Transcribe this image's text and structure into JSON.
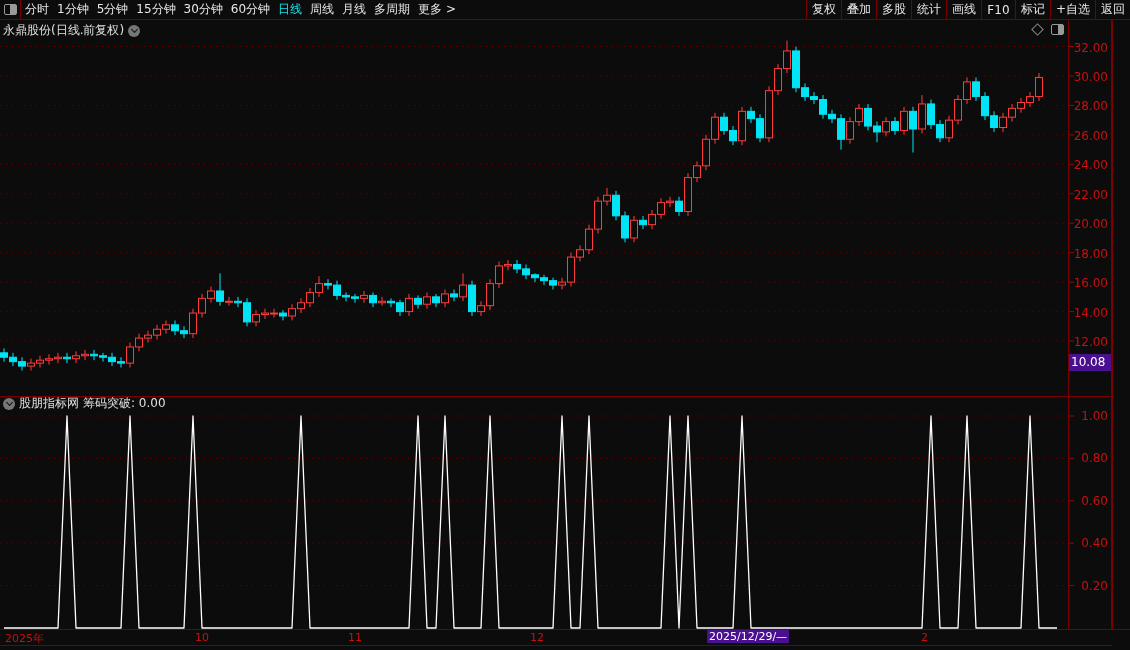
{
  "toolbar": {
    "periods": [
      {
        "label": "分时",
        "selected": false
      },
      {
        "label": "1分钟",
        "selected": false
      },
      {
        "label": "5分钟",
        "selected": false
      },
      {
        "label": "15分钟",
        "selected": false
      },
      {
        "label": "30分钟",
        "selected": false
      },
      {
        "label": "60分钟",
        "selected": false
      },
      {
        "label": "日线",
        "selected": true
      },
      {
        "label": "周线",
        "selected": false
      },
      {
        "label": "月线",
        "selected": false
      },
      {
        "label": "多周期",
        "selected": false
      },
      {
        "label": "更多 >",
        "selected": false
      }
    ],
    "actions": [
      "复权",
      "叠加",
      "多股",
      "统计",
      "画线",
      "F10",
      "标记",
      "+自选",
      "返回"
    ]
  },
  "main_chart": {
    "title": "永鼎股份(日线.前复权)",
    "cursor_price": "10.08",
    "chart_data": {
      "type": "candlestick",
      "grid": true,
      "ylim": [
        8.2,
        33.8
      ],
      "yticks": [
        {
          "value": 32,
          "label": "32.00"
        },
        {
          "value": 30,
          "label": "30.00"
        },
        {
          "value": 28,
          "label": "28.00"
        },
        {
          "value": 26,
          "label": "26.00"
        },
        {
          "value": 24,
          "label": "24.00"
        },
        {
          "value": 22,
          "label": "22.00"
        },
        {
          "value": 20,
          "label": "20.00"
        },
        {
          "value": 18,
          "label": "18.00"
        },
        {
          "value": 16,
          "label": "16.00"
        },
        {
          "value": 14,
          "label": "14.00"
        },
        {
          "value": 12,
          "label": "12.00"
        }
      ],
      "ohlc": [
        [
          11.2,
          11.5,
          10.6,
          10.9
        ],
        [
          10.9,
          11.2,
          10.3,
          10.6
        ],
        [
          10.6,
          10.9,
          10.0,
          10.3
        ],
        [
          10.3,
          10.8,
          10.0,
          10.5
        ],
        [
          10.5,
          11.0,
          10.2,
          10.7
        ],
        [
          10.7,
          11.1,
          10.4,
          10.8
        ],
        [
          10.8,
          11.2,
          10.5,
          10.9
        ],
        [
          10.9,
          11.2,
          10.5,
          10.8
        ],
        [
          10.8,
          11.3,
          10.5,
          11.0
        ],
        [
          11.0,
          11.4,
          10.7,
          11.1
        ],
        [
          11.1,
          11.4,
          10.7,
          11.0
        ],
        [
          11.0,
          11.2,
          10.6,
          10.9
        ],
        [
          10.9,
          11.2,
          10.3,
          10.6
        ],
        [
          10.6,
          10.9,
          10.2,
          10.5
        ],
        [
          10.5,
          11.9,
          10.2,
          11.6
        ],
        [
          11.6,
          12.5,
          11.3,
          12.2
        ],
        [
          12.2,
          12.7,
          11.9,
          12.4
        ],
        [
          12.4,
          13.1,
          12.1,
          12.8
        ],
        [
          12.8,
          13.4,
          12.5,
          13.1
        ],
        [
          13.1,
          13.4,
          12.4,
          12.7
        ],
        [
          12.7,
          13.0,
          12.2,
          12.5
        ],
        [
          12.5,
          14.2,
          12.2,
          13.9
        ],
        [
          13.9,
          15.2,
          13.6,
          14.9
        ],
        [
          14.9,
          15.7,
          14.6,
          15.4
        ],
        [
          15.4,
          16.6,
          14.4,
          14.7
        ],
        [
          14.7,
          15.0,
          14.4,
          14.7
        ],
        [
          14.7,
          15.0,
          14.3,
          14.6
        ],
        [
          14.6,
          14.9,
          13.0,
          13.3
        ],
        [
          13.3,
          14.1,
          13.0,
          13.8
        ],
        [
          13.8,
          14.2,
          13.5,
          13.9
        ],
        [
          13.9,
          14.2,
          13.6,
          13.9
        ],
        [
          13.9,
          14.1,
          13.4,
          13.7
        ],
        [
          13.7,
          14.5,
          13.4,
          14.2
        ],
        [
          14.2,
          14.9,
          13.9,
          14.6
        ],
        [
          14.6,
          15.6,
          14.3,
          15.3
        ],
        [
          15.3,
          16.4,
          15.0,
          15.9
        ],
        [
          15.9,
          16.2,
          15.5,
          15.8
        ],
        [
          15.8,
          16.1,
          14.8,
          15.1
        ],
        [
          15.1,
          15.3,
          14.7,
          15.0
        ],
        [
          15.0,
          15.2,
          14.6,
          14.9
        ],
        [
          14.9,
          15.4,
          14.6,
          15.1
        ],
        [
          15.1,
          15.3,
          14.3,
          14.6
        ],
        [
          14.6,
          15.0,
          14.4,
          14.7
        ],
        [
          14.7,
          14.9,
          14.3,
          14.6
        ],
        [
          14.6,
          14.8,
          13.7,
          14.0
        ],
        [
          14.0,
          15.2,
          13.7,
          14.9
        ],
        [
          14.9,
          15.1,
          14.2,
          14.5
        ],
        [
          14.5,
          15.3,
          14.2,
          15.0
        ],
        [
          15.0,
          15.2,
          14.3,
          14.6
        ],
        [
          14.6,
          15.5,
          14.3,
          15.2
        ],
        [
          15.2,
          15.5,
          14.7,
          15.0
        ],
        [
          15.0,
          16.6,
          14.7,
          15.8
        ],
        [
          15.8,
          16.1,
          13.7,
          14.0
        ],
        [
          14.0,
          14.7,
          13.7,
          14.4
        ],
        [
          14.4,
          16.2,
          14.1,
          15.9
        ],
        [
          15.9,
          17.4,
          15.6,
          17.1
        ],
        [
          17.1,
          17.5,
          16.8,
          17.2
        ],
        [
          17.2,
          17.5,
          16.6,
          16.9
        ],
        [
          16.9,
          17.2,
          16.2,
          16.5
        ],
        [
          16.5,
          16.6,
          16.0,
          16.3
        ],
        [
          16.3,
          16.5,
          15.8,
          16.1
        ],
        [
          16.1,
          16.3,
          15.5,
          15.8
        ],
        [
          15.8,
          16.3,
          15.5,
          16.0
        ],
        [
          16.0,
          18.0,
          15.7,
          17.7
        ],
        [
          17.7,
          18.5,
          17.4,
          18.2
        ],
        [
          18.2,
          19.9,
          17.9,
          19.6
        ],
        [
          19.6,
          21.8,
          19.3,
          21.5
        ],
        [
          21.5,
          22.4,
          21.2,
          21.9
        ],
        [
          21.9,
          22.2,
          20.2,
          20.5
        ],
        [
          20.5,
          20.8,
          18.7,
          19.0
        ],
        [
          19.0,
          20.5,
          18.7,
          20.2
        ],
        [
          20.2,
          20.5,
          19.6,
          19.9
        ],
        [
          19.9,
          20.9,
          19.6,
          20.6
        ],
        [
          20.6,
          21.7,
          20.3,
          21.4
        ],
        [
          21.4,
          21.8,
          21.1,
          21.5
        ],
        [
          21.5,
          21.8,
          20.5,
          20.8
        ],
        [
          20.8,
          23.4,
          20.5,
          23.1
        ],
        [
          23.1,
          24.2,
          22.8,
          23.9
        ],
        [
          23.9,
          26.0,
          23.6,
          25.7
        ],
        [
          25.7,
          27.5,
          25.4,
          27.2
        ],
        [
          27.2,
          27.5,
          26.0,
          26.3
        ],
        [
          26.3,
          26.6,
          25.3,
          25.6
        ],
        [
          25.6,
          27.9,
          25.3,
          27.6
        ],
        [
          27.6,
          27.9,
          26.8,
          27.1
        ],
        [
          27.1,
          27.4,
          25.5,
          25.8
        ],
        [
          25.8,
          29.3,
          25.5,
          29.0
        ],
        [
          29.0,
          30.8,
          28.7,
          30.5
        ],
        [
          30.5,
          32.4,
          30.2,
          31.7
        ],
        [
          31.7,
          32.0,
          28.9,
          29.2
        ],
        [
          29.2,
          29.5,
          28.3,
          28.6
        ],
        [
          28.6,
          28.9,
          28.1,
          28.4
        ],
        [
          28.4,
          28.7,
          27.1,
          27.4
        ],
        [
          27.4,
          27.7,
          26.8,
          27.1
        ],
        [
          27.1,
          27.4,
          25.0,
          25.7
        ],
        [
          25.7,
          27.2,
          25.4,
          26.9
        ],
        [
          26.9,
          28.1,
          26.6,
          27.8
        ],
        [
          27.8,
          28.1,
          26.3,
          26.6
        ],
        [
          26.6,
          26.9,
          25.5,
          26.2
        ],
        [
          26.2,
          27.2,
          25.9,
          26.9
        ],
        [
          26.9,
          27.2,
          26.0,
          26.3
        ],
        [
          26.3,
          27.9,
          26.0,
          27.6
        ],
        [
          27.6,
          27.9,
          24.8,
          26.4
        ],
        [
          26.4,
          28.7,
          26.1,
          28.1
        ],
        [
          28.1,
          28.4,
          26.4,
          26.7
        ],
        [
          26.7,
          27.0,
          25.5,
          25.8
        ],
        [
          25.8,
          27.3,
          25.5,
          27.0
        ],
        [
          27.0,
          28.7,
          26.7,
          28.4
        ],
        [
          28.4,
          29.9,
          28.1,
          29.6
        ],
        [
          29.6,
          29.9,
          28.3,
          28.6
        ],
        [
          28.6,
          28.9,
          27.0,
          27.3
        ],
        [
          27.3,
          27.6,
          26.2,
          26.5
        ],
        [
          26.5,
          27.5,
          26.2,
          27.2
        ],
        [
          27.2,
          28.1,
          26.9,
          27.8
        ],
        [
          27.8,
          28.5,
          27.5,
          28.2
        ],
        [
          28.2,
          28.9,
          27.9,
          28.6
        ],
        [
          28.6,
          30.2,
          28.3,
          29.9
        ]
      ]
    }
  },
  "indicator": {
    "title": "股朋指标网",
    "reading": "筹码突破: 0.00",
    "chart_data": {
      "type": "line",
      "grid": true,
      "ylim": [
        0,
        1
      ],
      "yticks": [
        {
          "value": 1,
          "label": "1.00"
        },
        {
          "value": 0.8,
          "label": "0.80"
        },
        {
          "value": 0.6,
          "label": "0.60"
        },
        {
          "value": 0.4,
          "label": "0.40"
        },
        {
          "value": 0.2,
          "label": "0.20"
        }
      ],
      "series": [
        {
          "color": "#ffffff",
          "values": [
            0,
            0,
            0,
            0,
            0,
            0,
            0,
            1,
            0,
            0,
            0,
            0,
            0,
            0,
            1,
            0,
            0,
            0,
            0,
            0,
            0,
            1,
            0,
            0,
            0,
            0,
            0,
            0,
            0,
            0,
            0,
            0,
            0,
            1,
            0,
            0,
            0,
            0,
            0,
            0,
            0,
            0,
            0,
            0,
            0,
            0,
            1,
            0,
            0,
            1,
            0,
            0,
            0,
            0,
            1,
            0,
            0,
            0,
            0,
            0,
            0,
            0,
            1,
            0,
            0,
            1,
            0,
            0,
            0,
            0,
            0,
            0,
            0,
            0,
            1,
            0,
            1,
            0,
            0,
            0,
            0,
            0,
            1,
            0,
            0,
            0,
            0,
            0,
            0,
            0,
            0,
            0,
            0,
            0,
            0,
            0,
            0,
            0,
            0,
            0,
            0,
            0,
            0,
            1,
            0,
            0,
            0,
            1,
            0,
            0,
            0,
            0,
            0,
            0,
            1,
            0,
            0,
            0
          ]
        }
      ]
    }
  },
  "x_axis": [
    {
      "label": "2025年",
      "kind": "tick"
    },
    {
      "label": "10",
      "kind": "tick"
    },
    {
      "label": "11",
      "kind": "tick"
    },
    {
      "label": "12",
      "kind": "tick"
    },
    {
      "label": "2025/12/29/—",
      "kind": "cursor"
    },
    {
      "label": "2",
      "kind": "tick"
    }
  ]
}
